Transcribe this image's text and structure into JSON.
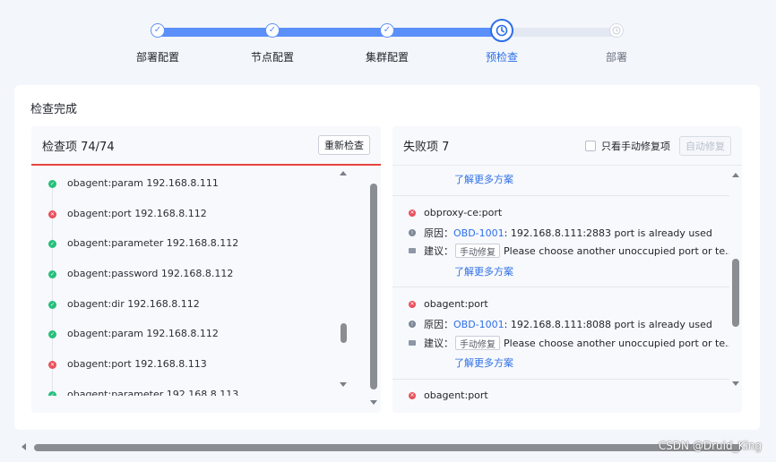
{
  "steps": [
    {
      "label": "部署配置",
      "state": "done"
    },
    {
      "label": "节点配置",
      "state": "done"
    },
    {
      "label": "集群配置",
      "state": "done"
    },
    {
      "label": "预检查",
      "state": "current"
    },
    {
      "label": "部署",
      "state": "pending"
    }
  ],
  "card": {
    "title": "检查完成"
  },
  "check_panel": {
    "title": "检查项 74/74",
    "recheck_button": "重新检查",
    "items": [
      {
        "text": "obagent:param 192.168.8.111",
        "status": "ok"
      },
      {
        "text": "obagent:port 192.168.8.112",
        "status": "fail"
      },
      {
        "text": "obagent:parameter 192.168.8.112",
        "status": "ok"
      },
      {
        "text": "obagent:password 192.168.8.112",
        "status": "ok"
      },
      {
        "text": "obagent:dir 192.168.8.112",
        "status": "ok"
      },
      {
        "text": "obagent:param 192.168.8.112",
        "status": "ok"
      },
      {
        "text": "obagent:port 192.168.8.113",
        "status": "fail"
      },
      {
        "text": "obagent:parameter 192.168.8.113",
        "status": "ok"
      }
    ]
  },
  "fail_panel": {
    "title": "失败项 7",
    "only_manual_label": "只看手动修复项",
    "auto_fix_button": "自动修复",
    "more_link": "了解更多方案",
    "reason_label": "原因：",
    "advice_label": "建议：",
    "manual_fix_tag": "手动修复",
    "items": [
      {
        "name": "obproxy-ce:port",
        "code": "OBD-1001",
        "reason": ": 192.168.8.111:2883 port is already used",
        "advice": "Please choose another unoccupied port or te..."
      },
      {
        "name": "obagent:port",
        "code": "OBD-1001",
        "reason": ": 192.168.8.111:8088 port is already used",
        "advice": "Please choose another unoccupied port or te..."
      },
      {
        "name": "obagent:port"
      }
    ]
  },
  "watermark": "CSDN @Druid_King",
  "colors": {
    "accent": "#2e6fe8",
    "ok": "#26bf7c",
    "fail": "#e8505b",
    "progress": "#5b8ff9"
  }
}
